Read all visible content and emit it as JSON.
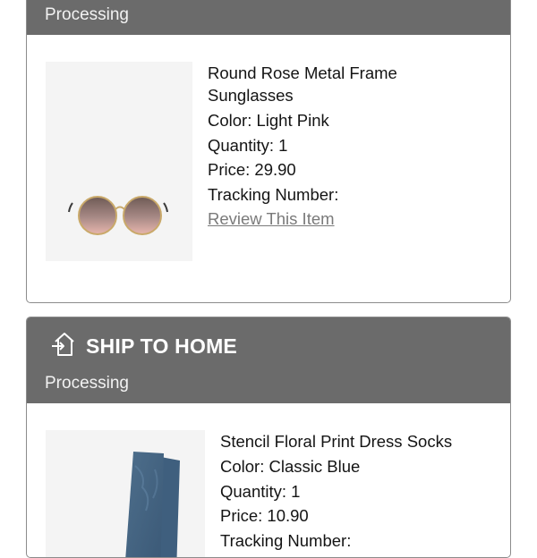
{
  "orders": [
    {
      "status": "Processing",
      "item": {
        "name": "Round Rose Metal Frame Sunglasses",
        "color": "Color: Light Pink",
        "quantity": "Quantity: 1",
        "price": "Price: 29.90",
        "tracking": "Tracking Number:",
        "review_link": "Review This Item"
      }
    },
    {
      "shipping_method": "SHIP TO HOME",
      "shipping_icon": "ship-to-home-icon",
      "status": "Processing",
      "item": {
        "name": "Stencil Floral Print Dress Socks",
        "color": "Color: Classic Blue",
        "quantity": "Quantity: 1",
        "price": "Price: 10.90",
        "tracking": "Tracking Number:"
      }
    }
  ],
  "colors": {
    "header_bg": "#6b6b6b",
    "border": "#8c8c8c",
    "link": "#7a7a7a",
    "image_bg": "#f4f4f4"
  }
}
